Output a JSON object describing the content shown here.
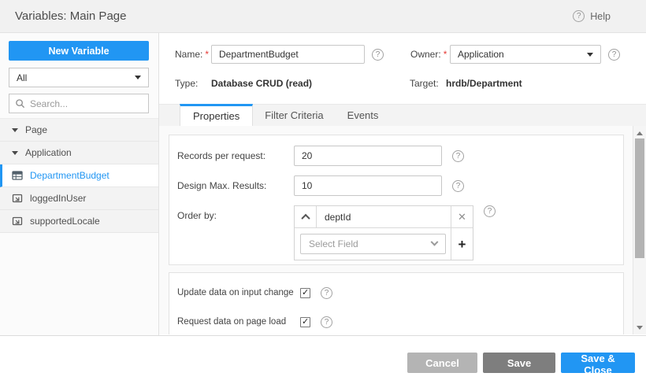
{
  "header": {
    "title": "Variables: Main Page",
    "help_label": "Help"
  },
  "sidebar": {
    "new_variable_label": "New Variable",
    "filter_value": "All",
    "search_placeholder": "Search...",
    "tree": [
      {
        "label": "Page",
        "type": "group",
        "expanded": true
      },
      {
        "label": "Application",
        "type": "group",
        "expanded": true
      },
      {
        "label": "DepartmentBudget",
        "type": "variable",
        "icon": "database-variable-icon",
        "selected": true
      },
      {
        "label": "loggedInUser",
        "type": "variable",
        "icon": "static-variable-icon",
        "selected": false
      },
      {
        "label": "supportedLocale",
        "type": "variable",
        "icon": "static-variable-icon",
        "selected": false
      }
    ]
  },
  "details": {
    "required_marker": "*",
    "name_label": "Name:",
    "name_value": "DepartmentBudget",
    "owner_label": "Owner:",
    "owner_value": "Application",
    "type_label": "Type:",
    "type_value": "Database CRUD (read)",
    "target_label": "Target:",
    "target_value": "hrdb/Department"
  },
  "tabs": [
    {
      "label": "Properties",
      "active": true
    },
    {
      "label": "Filter Criteria",
      "active": false
    },
    {
      "label": "Events",
      "active": false
    }
  ],
  "properties": {
    "records_per_request": {
      "label": "Records per request:",
      "value": "20"
    },
    "design_max_results": {
      "label": "Design Max. Results:",
      "value": "10"
    },
    "order_by": {
      "label": "Order by:",
      "field": "deptId",
      "select_placeholder": "Select Field"
    },
    "update_on_input_change": {
      "label": "Update data on input change",
      "checked": true
    },
    "request_on_page_load": {
      "label": "Request data on page load",
      "checked": true
    }
  },
  "footer": {
    "cancel_label": "Cancel",
    "save_label": "Save",
    "save_close_label": "Save & Close"
  },
  "colors": {
    "accent": "#2196f3",
    "cancel_button": "#b4b4b4",
    "save_button": "#7e7e7e",
    "required_marker": "#e53935"
  }
}
